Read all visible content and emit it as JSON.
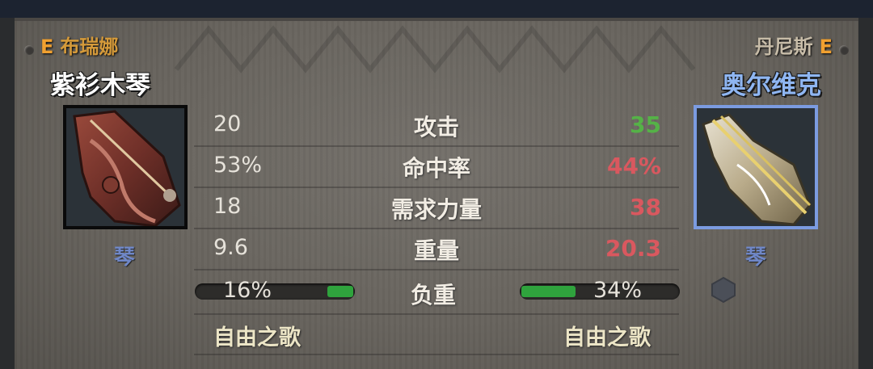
{
  "left": {
    "rank": "E",
    "owner": "布瑞娜",
    "item_name": "紫衫木琴",
    "item_type": "琴",
    "attack": "20",
    "hit_rate": "53%",
    "strength_req": "18",
    "weight": "9.6",
    "load_text": "16%",
    "load_fraction": 0.16,
    "song": "自由之歌"
  },
  "right": {
    "rank": "E",
    "owner": "丹尼斯",
    "item_name": "奥尔维克",
    "item_type": "琴",
    "attack": "35",
    "hit_rate": "44%",
    "strength_req": "38",
    "weight": "20.3",
    "load_text": "34%",
    "load_fraction": 0.34,
    "song": "自由之歌"
  },
  "labels": {
    "attack": "攻击",
    "hit_rate": "命中率",
    "strength_req": "需求力量",
    "weight": "重量",
    "load": "负重"
  },
  "colors": {
    "better": "#55b247",
    "worse": "#d9585f",
    "rank": "#f0a030",
    "left_name": "#ffffff",
    "right_name": "#8fb6f2"
  }
}
